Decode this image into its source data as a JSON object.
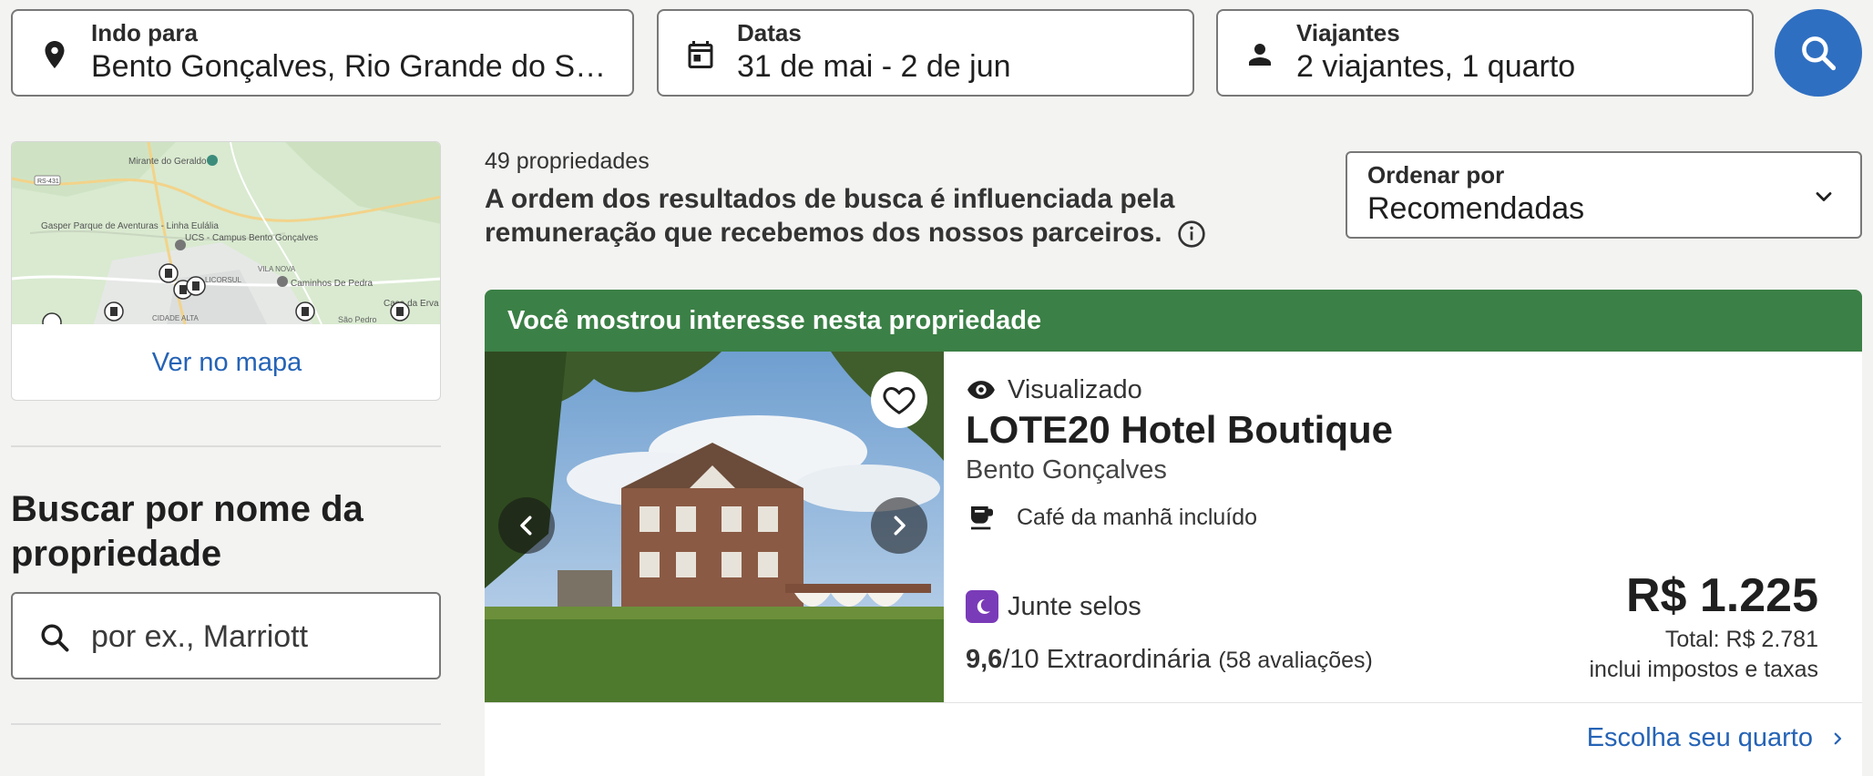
{
  "search": {
    "destination": {
      "label": "Indo para",
      "value": "Bento Gonçalves, Rio Grande do Sul, Brasil"
    },
    "dates": {
      "label": "Datas",
      "value": "31 de mai - 2 de jun"
    },
    "travelers": {
      "label": "Viajantes",
      "value": "2 viajantes, 1 quarto"
    }
  },
  "map": {
    "link_label": "Ver no mapa",
    "places": [
      "Mirante do Geraldo",
      "Gasper Parque de Aventuras - Linha Eulália",
      "UCS - Campus Bento Gonçalves",
      "Caminhos De Pedra",
      "Casa da Erva Mate",
      "VILA NOVA",
      "LICORSUL",
      "CIDADE ALTA",
      "São Pedro",
      "RS-431"
    ]
  },
  "property_search": {
    "title": "Buscar por nome da propriedade",
    "placeholder": "por ex., Marriott"
  },
  "results": {
    "count": "49 propriedades",
    "disclaimer": "A ordem dos resultados de busca é influenciada pela remuneração que recebemos dos nossos parceiros."
  },
  "sort": {
    "label": "Ordenar por",
    "value": "Recomendadas"
  },
  "card": {
    "banner": "Você mostrou interesse nesta propriedade",
    "viewed": "Visualizado",
    "name": "LOTE20 Hotel Boutique",
    "city": "Bento Gonçalves",
    "amenity": "Café da manhã incluído",
    "stamps": "Junte selos",
    "rating_score": "9,6",
    "rating_scale": "/10",
    "rating_label": "Extraordinária",
    "reviews": "(58 avaliações)",
    "price": "R$ 1.225",
    "total": "Total: R$ 2.781",
    "tax_note": "inclui impostos e taxas",
    "cta": "Escolha seu quarto"
  },
  "colors": {
    "accent_blue": "#2f6fc1",
    "link_blue": "#2563b6",
    "banner_green": "#3b8046",
    "stamps_purple": "#7a3bb8"
  },
  "icons": [
    "location-pin-icon",
    "calendar-icon",
    "person-icon",
    "search-icon",
    "chevron-down-icon",
    "info-icon",
    "heart-icon",
    "chevron-left-icon",
    "chevron-right-icon",
    "eye-icon",
    "coffee-cup-icon",
    "moon-icon"
  ]
}
